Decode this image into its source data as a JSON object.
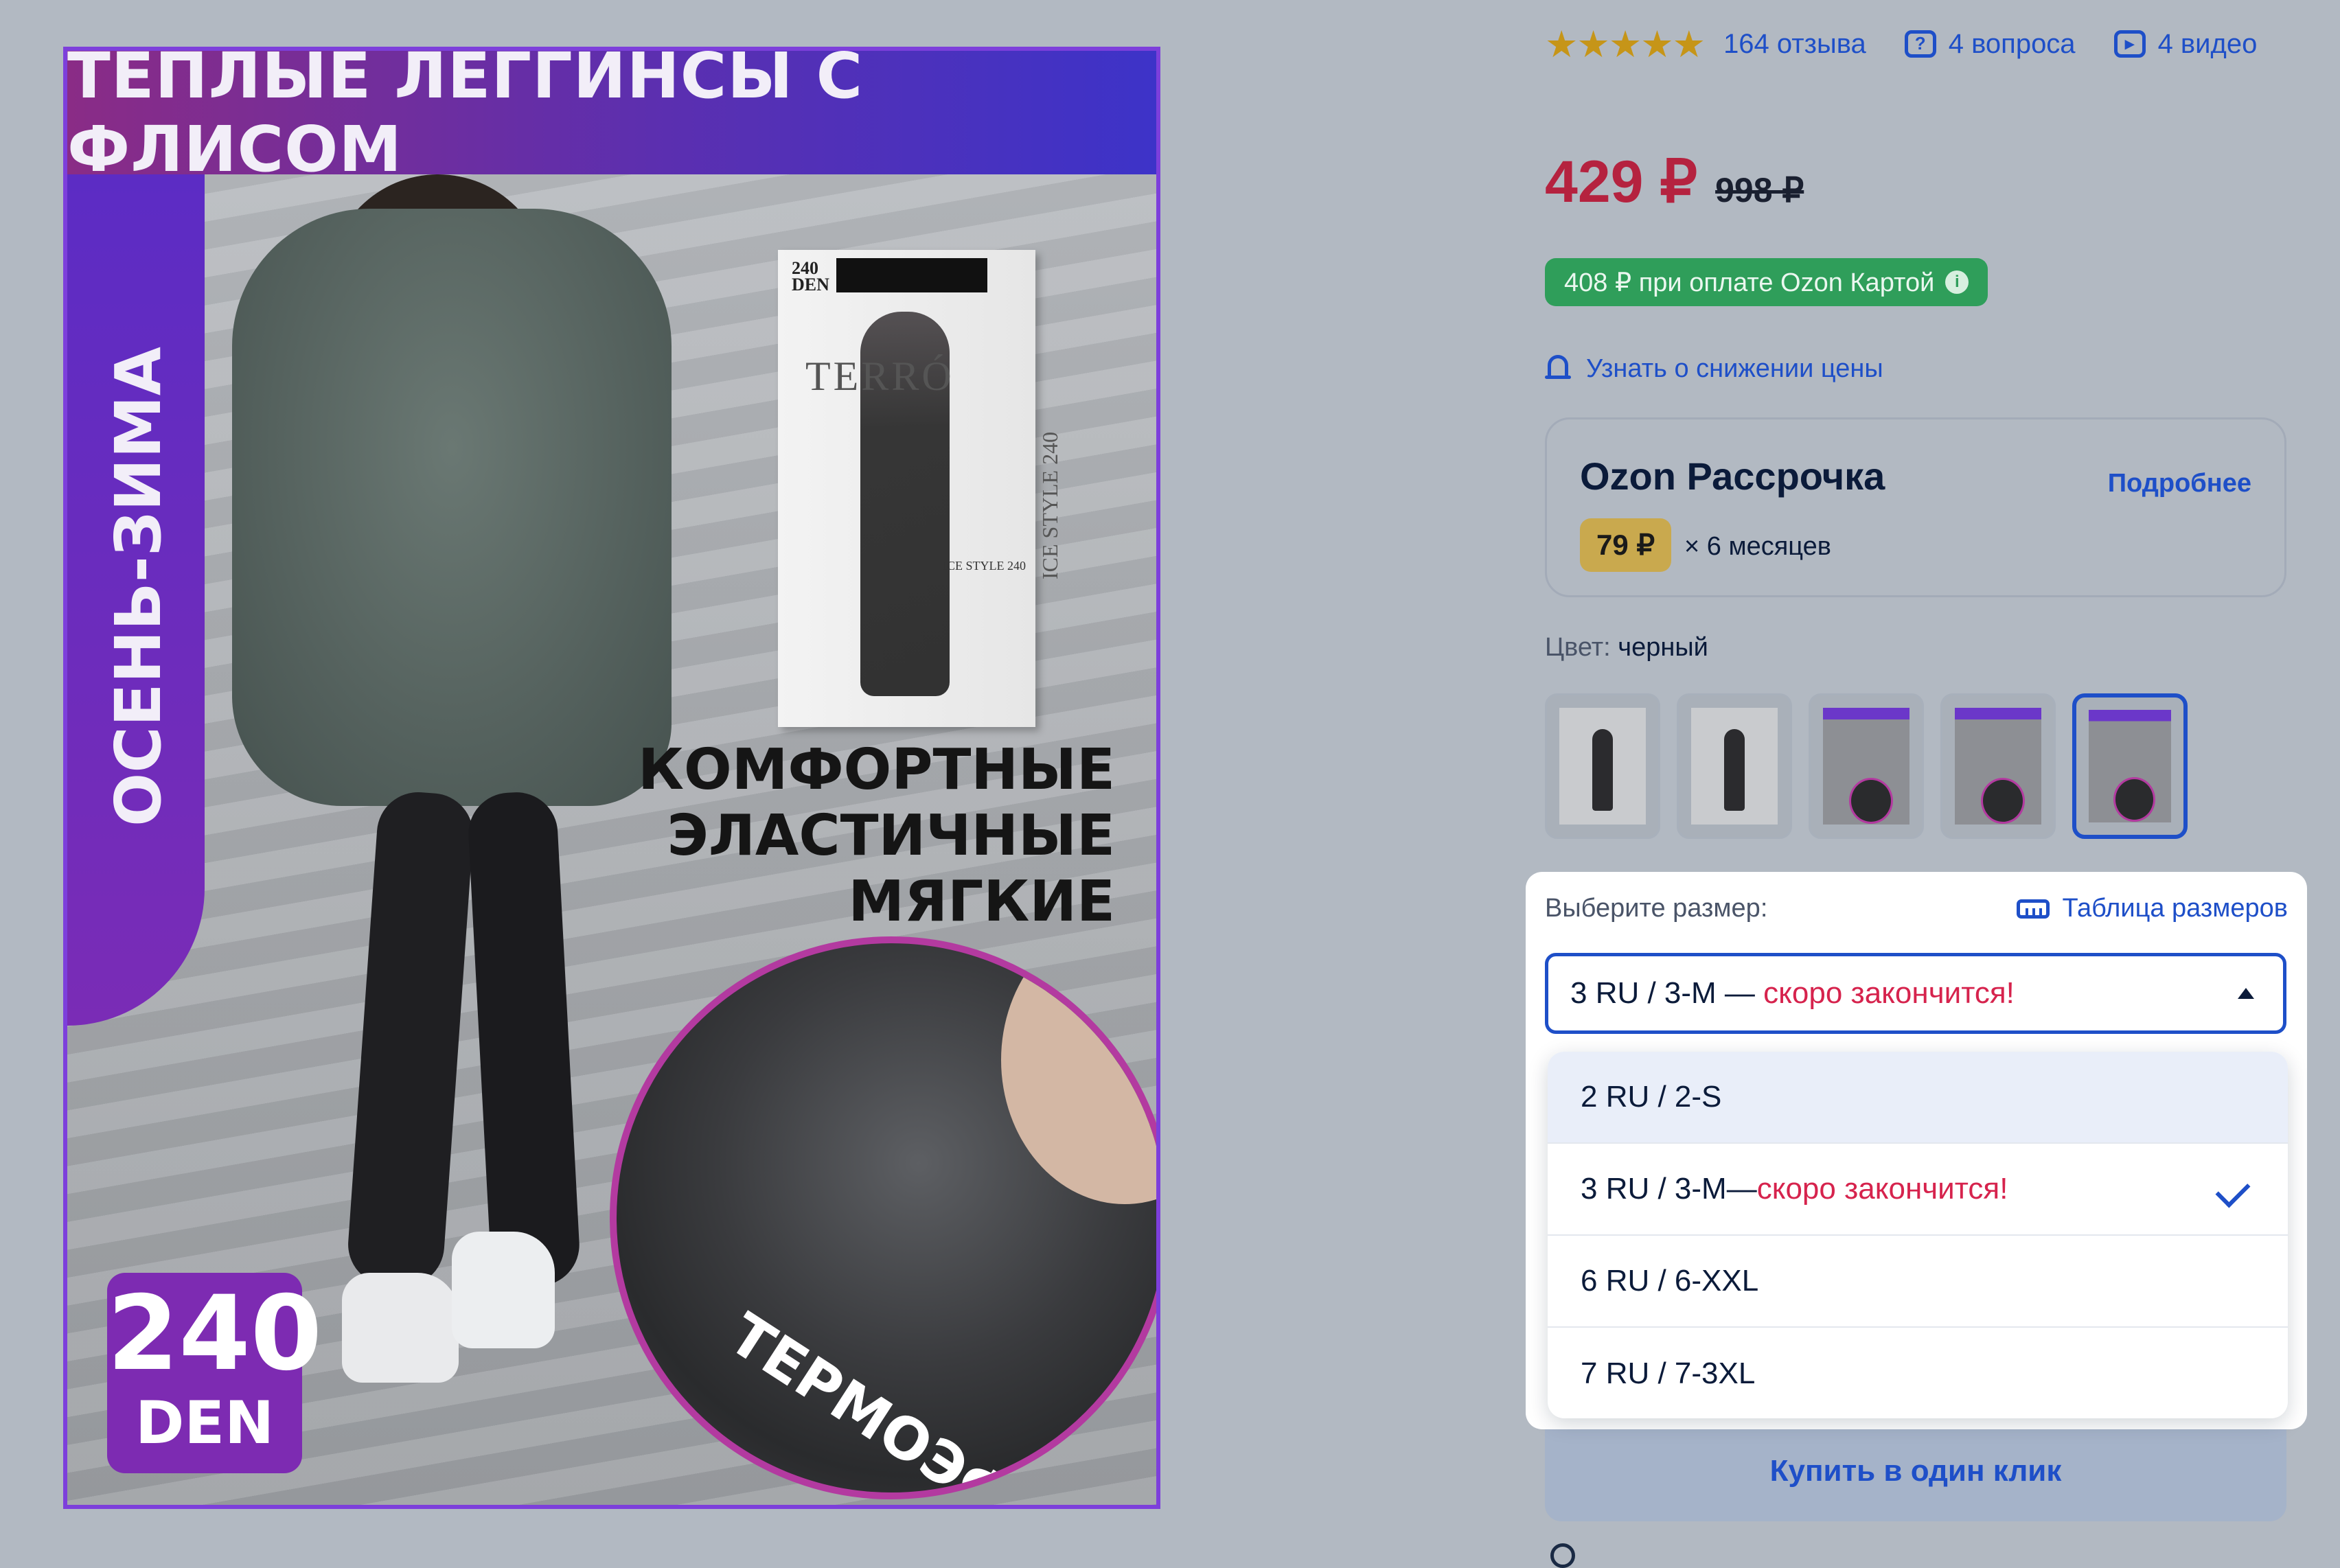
{
  "image": {
    "top_banner": "ТЕПЛЫЕ ЛЕГГИНСЫ С ФЛИСОМ",
    "side_banner": "ОСЕНЬ-ЗИМА",
    "package_den": "240\nDEN",
    "package_brand": "TERRÓ",
    "package_side": "ICE STYLE 240",
    "package_style": "ICE STYLE 240",
    "features": [
      "КОМФОРТНЫЕ",
      "ЭЛАСТИЧНЫЕ",
      "МЯГКИЕ"
    ],
    "thermo": "ТЕРМОЭФФЕКТ",
    "den_number": "240",
    "den_unit": "DEN"
  },
  "rating": {
    "stars": "★★★★★",
    "reviews": "164 отзыва",
    "questions": "4 вопроса",
    "videos": "4 видео"
  },
  "price": {
    "current": "429 ₽",
    "old": "998 ₽",
    "ozon_card": "408 ₽ при оплате Ozon Картой",
    "alert": "Узнать о снижении цены"
  },
  "installment": {
    "title": "Ozon Рассрочка",
    "more": "Подробнее",
    "amount": "79 ₽",
    "months": "× 6 месяцев"
  },
  "color": {
    "label": "Цвет:",
    "value": "черный"
  },
  "size": {
    "label": "Выберите размер:",
    "table_link": "Таблица размеров",
    "selected_main": "3 RU / 3-M — ",
    "selected_warn": "скоро закончится!",
    "options": [
      {
        "text": "2 RU / 2-S",
        "warn": ""
      },
      {
        "text": "3 RU / 3-M—",
        "warn": "скоро закончится!"
      },
      {
        "text": "6 RU / 6-XXL",
        "warn": ""
      },
      {
        "text": "7 RU / 7-3XL",
        "warn": ""
      }
    ]
  },
  "buy_one_click": "Купить в один клик",
  "colors": {
    "accent": "#1e4fc8",
    "price": "#b5223f",
    "warning": "#d6234d",
    "ozon_card_green": "#2f9e5a"
  }
}
